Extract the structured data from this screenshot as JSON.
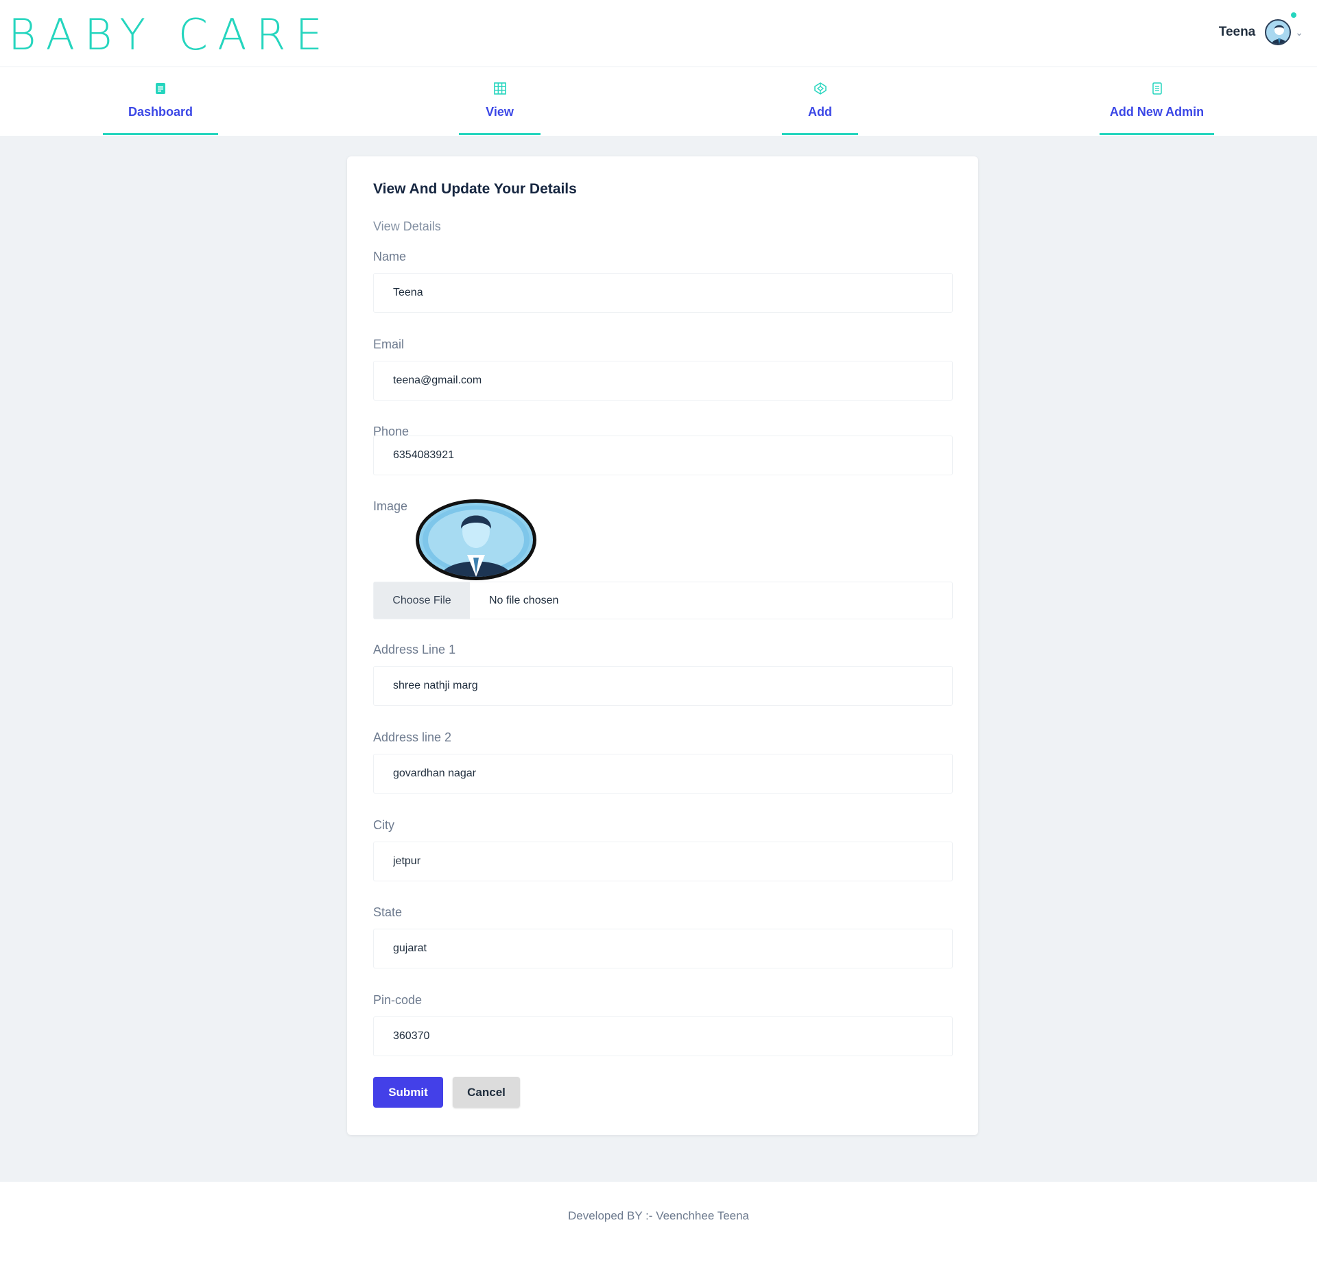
{
  "header": {
    "logo_text": "BABY CARE",
    "user_name": "Teena",
    "accent_color": "#25d5be"
  },
  "nav": {
    "items": [
      {
        "label": "Dashboard",
        "icon": "document-icon"
      },
      {
        "label": "View",
        "icon": "table-icon"
      },
      {
        "label": "Add",
        "icon": "codepen-icon"
      },
      {
        "label": "Add New Admin",
        "icon": "file-text-icon"
      }
    ]
  },
  "form": {
    "title": "View And Update Your Details",
    "subtitle": "View Details",
    "name_label": "Name",
    "name_value": "Teena",
    "email_label": "Email",
    "email_value": "teena@gmail.com",
    "phone_label": "Phone",
    "phone_value": "6354083921",
    "image_label": "Image",
    "file_button": "Choose File",
    "file_status": "No file chosen",
    "address1_label": "Address Line 1",
    "address1_value": "shree nathji marg",
    "address2_label": "Address line 2",
    "address2_value": "govardhan nagar",
    "city_label": "City",
    "city_value": "jetpur",
    "state_label": "State",
    "state_value": "gujarat",
    "pincode_label": "Pin-code",
    "pincode_value": "360370",
    "submit_label": "Submit",
    "cancel_label": "Cancel",
    "submit_color": "#4340e8"
  },
  "footer": {
    "text": "Developed BY :- Veenchhee Teena"
  }
}
